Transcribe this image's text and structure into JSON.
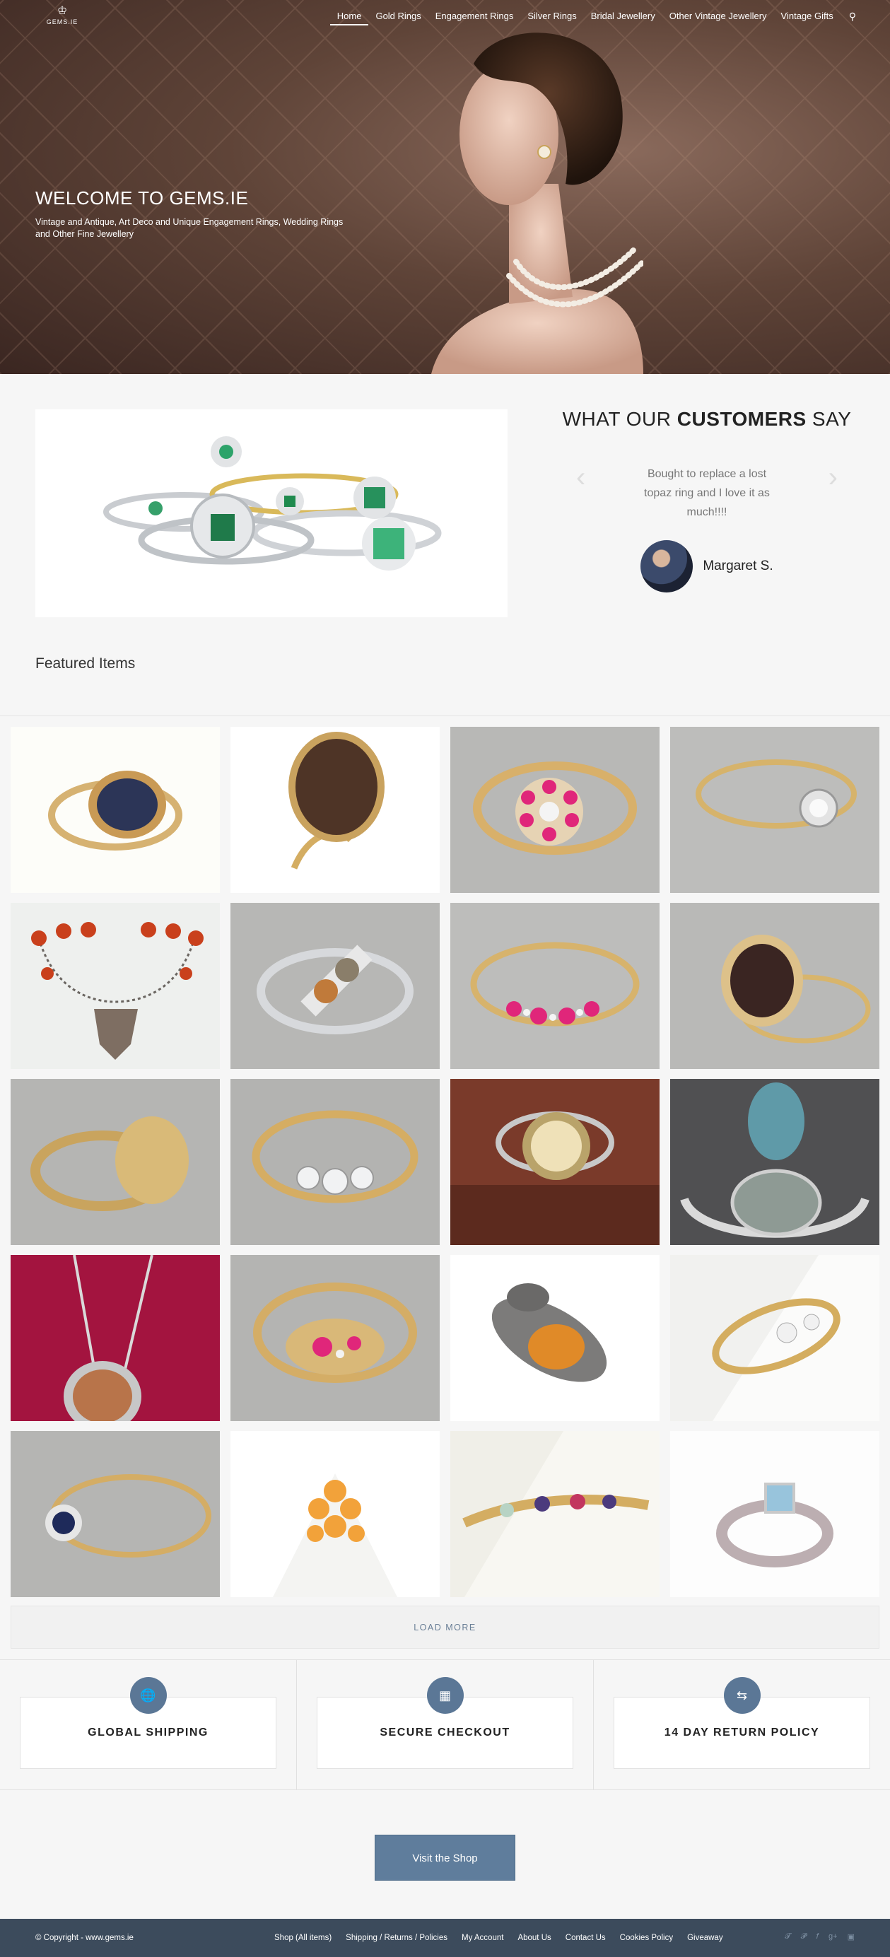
{
  "header": {
    "logo_text": "GEMS.IE",
    "nav": [
      "Home",
      "Gold Rings",
      "Engagement Rings",
      "Silver Rings",
      "Bridal Jewellery",
      "Other Vintage Jewellery",
      "Vintage Gifts"
    ],
    "search_icon": "search-icon"
  },
  "hero": {
    "title": "WELCOME TO GEMS.IE",
    "subtitle": "Vintage and Antique, Art Deco and Unique Engagement Rings, Wedding Rings and Other Fine Jewellery"
  },
  "testimonial": {
    "title_pre": "WHAT OUR ",
    "title_bold": "CUSTOMERS",
    "title_post": " SAY",
    "quote": "Bought to replace a lost topaz ring and I love it as much!!!!",
    "name": "Margaret S."
  },
  "featured": {
    "title": "Featured Items",
    "load_more": "LOAD MORE"
  },
  "features": [
    {
      "label": "GLOBAL SHIPPING",
      "icon": "globe-icon"
    },
    {
      "label": "SECURE CHECKOUT",
      "icon": "lock-icon"
    },
    {
      "label": "14 DAY RETURN POLICY",
      "icon": "return-icon"
    }
  ],
  "shop_button": "Visit the Shop",
  "footer": {
    "copyright": "© Copyright - www.gems.ie",
    "links": [
      "Shop (All items)",
      "Shipping / Returns / Policies",
      "My Account",
      "About Us",
      "Contact Us",
      "Cookies Policy",
      "Giveaway"
    ],
    "social": [
      "twitter-icon",
      "pinterest-icon",
      "facebook-icon",
      "gplus-icon",
      "instagram-icon"
    ]
  },
  "colors": {
    "accent": "#5f7d9c",
    "footer": "#3c4b5c"
  }
}
